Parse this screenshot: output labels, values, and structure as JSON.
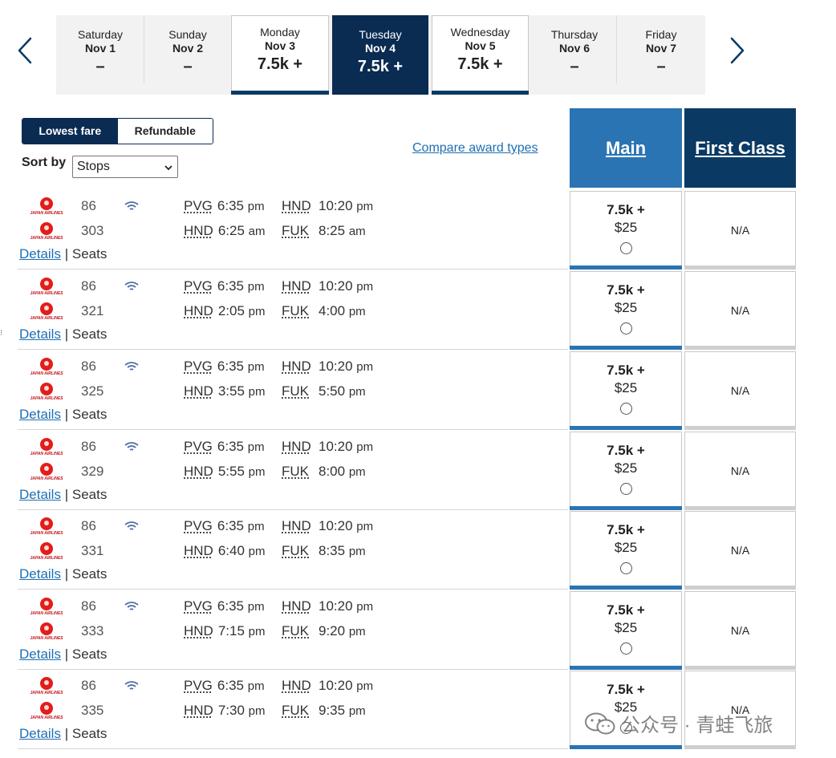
{
  "date_strip": {
    "days": [
      {
        "name": "Saturday",
        "date": "Nov 1",
        "price": "–",
        "state": "unavailable"
      },
      {
        "name": "Sunday",
        "date": "Nov 2",
        "price": "–",
        "state": "unavailable"
      },
      {
        "name": "Monday",
        "date": "Nov 3",
        "price": "7.5k +",
        "state": "available"
      },
      {
        "name": "Tuesday",
        "date": "Nov 4",
        "price": "7.5k +",
        "state": "selected"
      },
      {
        "name": "Wednesday",
        "date": "Nov 5",
        "price": "7.5k +",
        "state": "available"
      },
      {
        "name": "Thursday",
        "date": "Nov 6",
        "price": "–",
        "state": "unavailable"
      },
      {
        "name": "Friday",
        "date": "Nov 7",
        "price": "–",
        "state": "unavailable"
      }
    ],
    "prev_icon": "chevron-left-icon",
    "next_icon": "chevron-right-icon"
  },
  "fare_toggle": {
    "lowest": "Lowest fare",
    "refundable": "Refundable",
    "active": "lowest"
  },
  "sort": {
    "label": "Sort by",
    "selected": "Stops"
  },
  "compare_link": "Compare award types",
  "cabins": {
    "main": "Main",
    "first": "First Class"
  },
  "colors": {
    "navy": "#0a2b52",
    "main_blue": "#2a74b3",
    "link": "#1f6fb2",
    "jal_red": "#e31d1a"
  },
  "airline_logo_text": "JAPAN AIRLINES",
  "links": {
    "details": "Details",
    "sep": "|",
    "seats": "Seats"
  },
  "flights": [
    {
      "leg1": {
        "no": "86",
        "from": "PVG",
        "dep": "6:35",
        "dep_ampm": "pm",
        "to": "HND",
        "arr": "10:20",
        "arr_ampm": "pm"
      },
      "leg2": {
        "no": "303",
        "from": "HND",
        "dep": "6:25",
        "dep_ampm": "am",
        "to": "FUK",
        "arr": "8:25",
        "arr_ampm": "am"
      },
      "main": {
        "points": "7.5k +",
        "tax": "$25"
      },
      "first": "N/A"
    },
    {
      "leg1": {
        "no": "86",
        "from": "PVG",
        "dep": "6:35",
        "dep_ampm": "pm",
        "to": "HND",
        "arr": "10:20",
        "arr_ampm": "pm"
      },
      "leg2": {
        "no": "321",
        "from": "HND",
        "dep": "2:05",
        "dep_ampm": "pm",
        "to": "FUK",
        "arr": "4:00",
        "arr_ampm": "pm"
      },
      "main": {
        "points": "7.5k +",
        "tax": "$25"
      },
      "first": "N/A"
    },
    {
      "leg1": {
        "no": "86",
        "from": "PVG",
        "dep": "6:35",
        "dep_ampm": "pm",
        "to": "HND",
        "arr": "10:20",
        "arr_ampm": "pm"
      },
      "leg2": {
        "no": "325",
        "from": "HND",
        "dep": "3:55",
        "dep_ampm": "pm",
        "to": "FUK",
        "arr": "5:50",
        "arr_ampm": "pm"
      },
      "main": {
        "points": "7.5k +",
        "tax": "$25"
      },
      "first": "N/A"
    },
    {
      "leg1": {
        "no": "86",
        "from": "PVG",
        "dep": "6:35",
        "dep_ampm": "pm",
        "to": "HND",
        "arr": "10:20",
        "arr_ampm": "pm"
      },
      "leg2": {
        "no": "329",
        "from": "HND",
        "dep": "5:55",
        "dep_ampm": "pm",
        "to": "FUK",
        "arr": "8:00",
        "arr_ampm": "pm"
      },
      "main": {
        "points": "7.5k +",
        "tax": "$25"
      },
      "first": "N/A"
    },
    {
      "leg1": {
        "no": "86",
        "from": "PVG",
        "dep": "6:35",
        "dep_ampm": "pm",
        "to": "HND",
        "arr": "10:20",
        "arr_ampm": "pm"
      },
      "leg2": {
        "no": "331",
        "from": "HND",
        "dep": "6:40",
        "dep_ampm": "pm",
        "to": "FUK",
        "arr": "8:35",
        "arr_ampm": "pm"
      },
      "main": {
        "points": "7.5k +",
        "tax": "$25"
      },
      "first": "N/A"
    },
    {
      "leg1": {
        "no": "86",
        "from": "PVG",
        "dep": "6:35",
        "dep_ampm": "pm",
        "to": "HND",
        "arr": "10:20",
        "arr_ampm": "pm"
      },
      "leg2": {
        "no": "333",
        "from": "HND",
        "dep": "7:15",
        "dep_ampm": "pm",
        "to": "FUK",
        "arr": "9:20",
        "arr_ampm": "pm"
      },
      "main": {
        "points": "7.5k +",
        "tax": "$25"
      },
      "first": "N/A"
    },
    {
      "leg1": {
        "no": "86",
        "from": "PVG",
        "dep": "6:35",
        "dep_ampm": "pm",
        "to": "HND",
        "arr": "10:20",
        "arr_ampm": "pm"
      },
      "leg2": {
        "no": "335",
        "from": "HND",
        "dep": "7:30",
        "dep_ampm": "pm",
        "to": "FUK",
        "arr": "9:35",
        "arr_ampm": "pm"
      },
      "main": {
        "points": "7.5k +",
        "tax": "$25"
      },
      "first": "N/A"
    }
  ],
  "watermark": {
    "text": "公众号 · 青蛙飞旅",
    "icon": "wechat-icon"
  }
}
